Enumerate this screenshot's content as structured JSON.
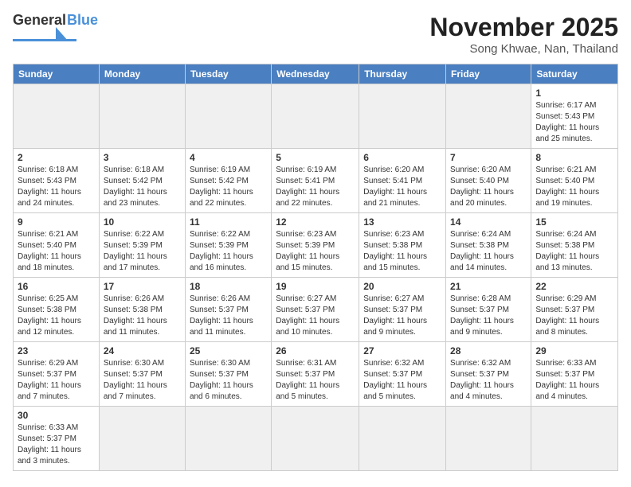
{
  "header": {
    "logo_general": "General",
    "logo_blue": "Blue",
    "month_title": "November 2025",
    "subtitle": "Song Khwae, Nan, Thailand"
  },
  "days_of_week": [
    "Sunday",
    "Monday",
    "Tuesday",
    "Wednesday",
    "Thursday",
    "Friday",
    "Saturday"
  ],
  "weeks": [
    [
      {
        "day": "",
        "info": ""
      },
      {
        "day": "",
        "info": ""
      },
      {
        "day": "",
        "info": ""
      },
      {
        "day": "",
        "info": ""
      },
      {
        "day": "",
        "info": ""
      },
      {
        "day": "",
        "info": ""
      },
      {
        "day": "1",
        "info": "Sunrise: 6:17 AM\nSunset: 5:43 PM\nDaylight: 11 hours\nand 25 minutes."
      }
    ],
    [
      {
        "day": "2",
        "info": "Sunrise: 6:18 AM\nSunset: 5:43 PM\nDaylight: 11 hours\nand 24 minutes."
      },
      {
        "day": "3",
        "info": "Sunrise: 6:18 AM\nSunset: 5:42 PM\nDaylight: 11 hours\nand 23 minutes."
      },
      {
        "day": "4",
        "info": "Sunrise: 6:19 AM\nSunset: 5:42 PM\nDaylight: 11 hours\nand 22 minutes."
      },
      {
        "day": "5",
        "info": "Sunrise: 6:19 AM\nSunset: 5:41 PM\nDaylight: 11 hours\nand 22 minutes."
      },
      {
        "day": "6",
        "info": "Sunrise: 6:20 AM\nSunset: 5:41 PM\nDaylight: 11 hours\nand 21 minutes."
      },
      {
        "day": "7",
        "info": "Sunrise: 6:20 AM\nSunset: 5:40 PM\nDaylight: 11 hours\nand 20 minutes."
      },
      {
        "day": "8",
        "info": "Sunrise: 6:21 AM\nSunset: 5:40 PM\nDaylight: 11 hours\nand 19 minutes."
      }
    ],
    [
      {
        "day": "9",
        "info": "Sunrise: 6:21 AM\nSunset: 5:40 PM\nDaylight: 11 hours\nand 18 minutes."
      },
      {
        "day": "10",
        "info": "Sunrise: 6:22 AM\nSunset: 5:39 PM\nDaylight: 11 hours\nand 17 minutes."
      },
      {
        "day": "11",
        "info": "Sunrise: 6:22 AM\nSunset: 5:39 PM\nDaylight: 11 hours\nand 16 minutes."
      },
      {
        "day": "12",
        "info": "Sunrise: 6:23 AM\nSunset: 5:39 PM\nDaylight: 11 hours\nand 15 minutes."
      },
      {
        "day": "13",
        "info": "Sunrise: 6:23 AM\nSunset: 5:38 PM\nDaylight: 11 hours\nand 15 minutes."
      },
      {
        "day": "14",
        "info": "Sunrise: 6:24 AM\nSunset: 5:38 PM\nDaylight: 11 hours\nand 14 minutes."
      },
      {
        "day": "15",
        "info": "Sunrise: 6:24 AM\nSunset: 5:38 PM\nDaylight: 11 hours\nand 13 minutes."
      }
    ],
    [
      {
        "day": "16",
        "info": "Sunrise: 6:25 AM\nSunset: 5:38 PM\nDaylight: 11 hours\nand 12 minutes."
      },
      {
        "day": "17",
        "info": "Sunrise: 6:26 AM\nSunset: 5:38 PM\nDaylight: 11 hours\nand 11 minutes."
      },
      {
        "day": "18",
        "info": "Sunrise: 6:26 AM\nSunset: 5:37 PM\nDaylight: 11 hours\nand 11 minutes."
      },
      {
        "day": "19",
        "info": "Sunrise: 6:27 AM\nSunset: 5:37 PM\nDaylight: 11 hours\nand 10 minutes."
      },
      {
        "day": "20",
        "info": "Sunrise: 6:27 AM\nSunset: 5:37 PM\nDaylight: 11 hours\nand 9 minutes."
      },
      {
        "day": "21",
        "info": "Sunrise: 6:28 AM\nSunset: 5:37 PM\nDaylight: 11 hours\nand 9 minutes."
      },
      {
        "day": "22",
        "info": "Sunrise: 6:29 AM\nSunset: 5:37 PM\nDaylight: 11 hours\nand 8 minutes."
      }
    ],
    [
      {
        "day": "23",
        "info": "Sunrise: 6:29 AM\nSunset: 5:37 PM\nDaylight: 11 hours\nand 7 minutes."
      },
      {
        "day": "24",
        "info": "Sunrise: 6:30 AM\nSunset: 5:37 PM\nDaylight: 11 hours\nand 7 minutes."
      },
      {
        "day": "25",
        "info": "Sunrise: 6:30 AM\nSunset: 5:37 PM\nDaylight: 11 hours\nand 6 minutes."
      },
      {
        "day": "26",
        "info": "Sunrise: 6:31 AM\nSunset: 5:37 PM\nDaylight: 11 hours\nand 5 minutes."
      },
      {
        "day": "27",
        "info": "Sunrise: 6:32 AM\nSunset: 5:37 PM\nDaylight: 11 hours\nand 5 minutes."
      },
      {
        "day": "28",
        "info": "Sunrise: 6:32 AM\nSunset: 5:37 PM\nDaylight: 11 hours\nand 4 minutes."
      },
      {
        "day": "29",
        "info": "Sunrise: 6:33 AM\nSunset: 5:37 PM\nDaylight: 11 hours\nand 4 minutes."
      }
    ],
    [
      {
        "day": "30",
        "info": "Sunrise: 6:33 AM\nSunset: 5:37 PM\nDaylight: 11 hours\nand 3 minutes."
      },
      {
        "day": "",
        "info": ""
      },
      {
        "day": "",
        "info": ""
      },
      {
        "day": "",
        "info": ""
      },
      {
        "day": "",
        "info": ""
      },
      {
        "day": "",
        "info": ""
      },
      {
        "day": "",
        "info": ""
      }
    ]
  ]
}
